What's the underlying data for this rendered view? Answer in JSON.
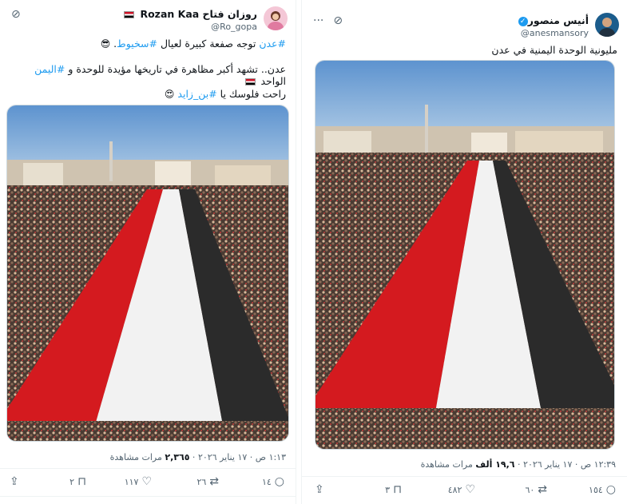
{
  "left_tweet": {
    "display_name": "روزان فتاح Rozan Kaa",
    "handle": "@Ro_gopa",
    "line1": {
      "tag": "#عدن",
      "text": " توجه صفعة كبيرة لعيال ",
      "tag2": "#سخيوط",
      "emoji": "😎"
    },
    "line2": {
      "text1": "عدن.. تشهد أكبر مظاهرة في تاريخها مؤيدة للوحدة و ",
      "tag": "#اليمن",
      "text2": " الواحد"
    },
    "line3": {
      "text": "راحت فلوسك يا ",
      "tag": "#بن_زايد",
      "emoji": "😍"
    },
    "meta": {
      "time": "١:١٣ ص · ١٧ يناير ٢٠٢٦",
      "views": "٢,٣٦٥",
      "views_label": "مرات مشاهدة"
    },
    "actions": {
      "replies": "١٤",
      "retweets": "٢٦",
      "likes": "١١٧",
      "bookmarks": "٢"
    }
  },
  "right_tweet": {
    "display_name": "أنيس منصور",
    "handle": "@anesmansory",
    "text": "مليونية الوحدة اليمنية في عدن",
    "meta": {
      "time": "١٢:٣٩ ص · ١٧ يناير ٢٠٢٦",
      "views": "١٩,٦ ألف",
      "views_label": "مرات مشاهدة"
    },
    "actions": {
      "replies": "١٥٤",
      "retweets": "٦٠",
      "likes": "٤٨٢",
      "bookmarks": "٣"
    }
  },
  "icons": {
    "more": "more-icon",
    "grok": "grok-icon",
    "reply": "reply-icon",
    "retweet": "retweet-icon",
    "like": "like-icon",
    "bookmark": "bookmark-icon",
    "share": "share-icon",
    "verified": "verified-badge-icon"
  },
  "colors": {
    "link": "#1d9bf0",
    "secondary": "#536471",
    "flag_red": "#ce1126",
    "flag_white": "#ffffff",
    "flag_black": "#000000"
  }
}
